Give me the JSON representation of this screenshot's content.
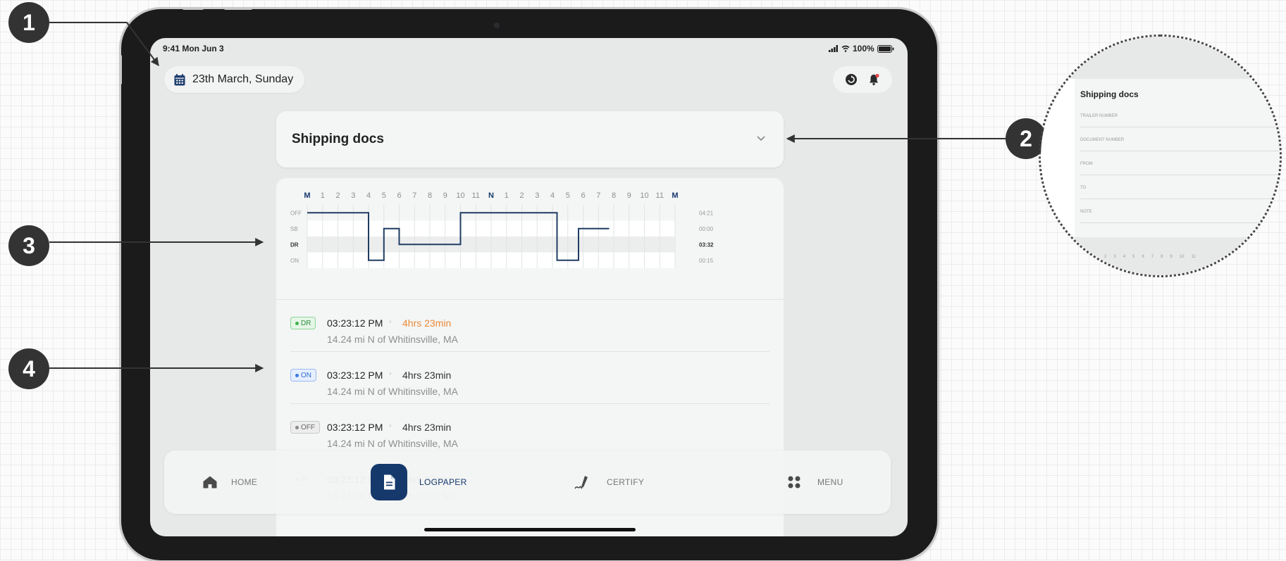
{
  "markers": [
    "1",
    "2",
    "3",
    "4"
  ],
  "status_bar": {
    "time": "9:41 Mon Jun 3",
    "battery": "100%"
  },
  "header": {
    "date": "23th March, Sunday"
  },
  "shipping": {
    "title": "Shipping docs"
  },
  "zoom": {
    "title": "Shipping docs",
    "fields": [
      "TRAILER NUMBER",
      "DOCUMENT NUMBER",
      "FROM",
      "TO",
      "NOTE"
    ],
    "ticks": [
      "2",
      "3",
      "4",
      "5",
      "6",
      "7",
      "8",
      "9",
      "10",
      "11"
    ]
  },
  "chart_data": {
    "type": "line",
    "x_ticks": [
      "M",
      "1",
      "2",
      "3",
      "4",
      "5",
      "6",
      "7",
      "8",
      "9",
      "10",
      "11",
      "N",
      "1",
      "2",
      "3",
      "4",
      "5",
      "6",
      "7",
      "8",
      "9",
      "10",
      "11",
      "M"
    ],
    "rows": [
      "OFF",
      "SB",
      "DR",
      "ON"
    ],
    "totals": [
      "04:21",
      "00:00",
      "03:32",
      "00:15"
    ],
    "series": [
      {
        "points": [
          [
            0,
            "OFF"
          ],
          [
            4,
            "OFF"
          ],
          [
            4,
            "ON"
          ],
          [
            5,
            "ON"
          ],
          [
            5,
            "SB"
          ],
          [
            6,
            "SB"
          ],
          [
            6,
            "DR"
          ],
          [
            10,
            "DR"
          ],
          [
            10,
            "OFF"
          ],
          [
            16.3,
            "OFF"
          ],
          [
            16.3,
            "ON"
          ],
          [
            17.7,
            "ON"
          ],
          [
            17.7,
            "SB"
          ],
          [
            19.7,
            "SB"
          ]
        ]
      }
    ]
  },
  "log": [
    {
      "status": "DR",
      "time": "03:23:12 PM",
      "sep": "›",
      "duration": "4hrs 23min",
      "location": "14.24 mi N of Whitinsville, MA",
      "dot": "#3fb34f",
      "bg": "#e5f6e7",
      "border": "#8ad69a",
      "fg": "#2e8b3e",
      "dur_color": "#e98b3a"
    },
    {
      "status": "ON",
      "time": "03:23:12 PM",
      "sep": "›",
      "duration": "4hrs 23min",
      "location": "14.24 mi N of Whitinsville, MA",
      "dot": "#3d7be0",
      "bg": "#e6efff",
      "border": "#99b9f0",
      "fg": "#2f6bd0",
      "dur_color": "#333333"
    },
    {
      "status": "OFF",
      "time": "03:23:12 PM",
      "sep": "›",
      "duration": "4hrs 23min",
      "location": "14.24 mi N of Whitinsville, MA",
      "dot": "#888888",
      "bg": "#ededed",
      "border": "#c9c9c9",
      "fg": "#666666",
      "dur_color": "#333333"
    },
    {
      "status": "PC",
      "time": "03:23:12 PM",
      "sep": "›",
      "duration": "4hrs 23min",
      "location": "14.24 mi N of Whitinsville, MA",
      "dot": "#888888",
      "bg": "#ededed",
      "border": "#c9c9c9",
      "fg": "#666666",
      "dur_color": "#333333"
    }
  ],
  "nav": {
    "home": "HOME",
    "logpaper": "LOGPAPER",
    "certify": "CERTIFY",
    "menu": "MENU"
  },
  "colors": {
    "accent": "#15396b",
    "line": "#1f3d63"
  }
}
